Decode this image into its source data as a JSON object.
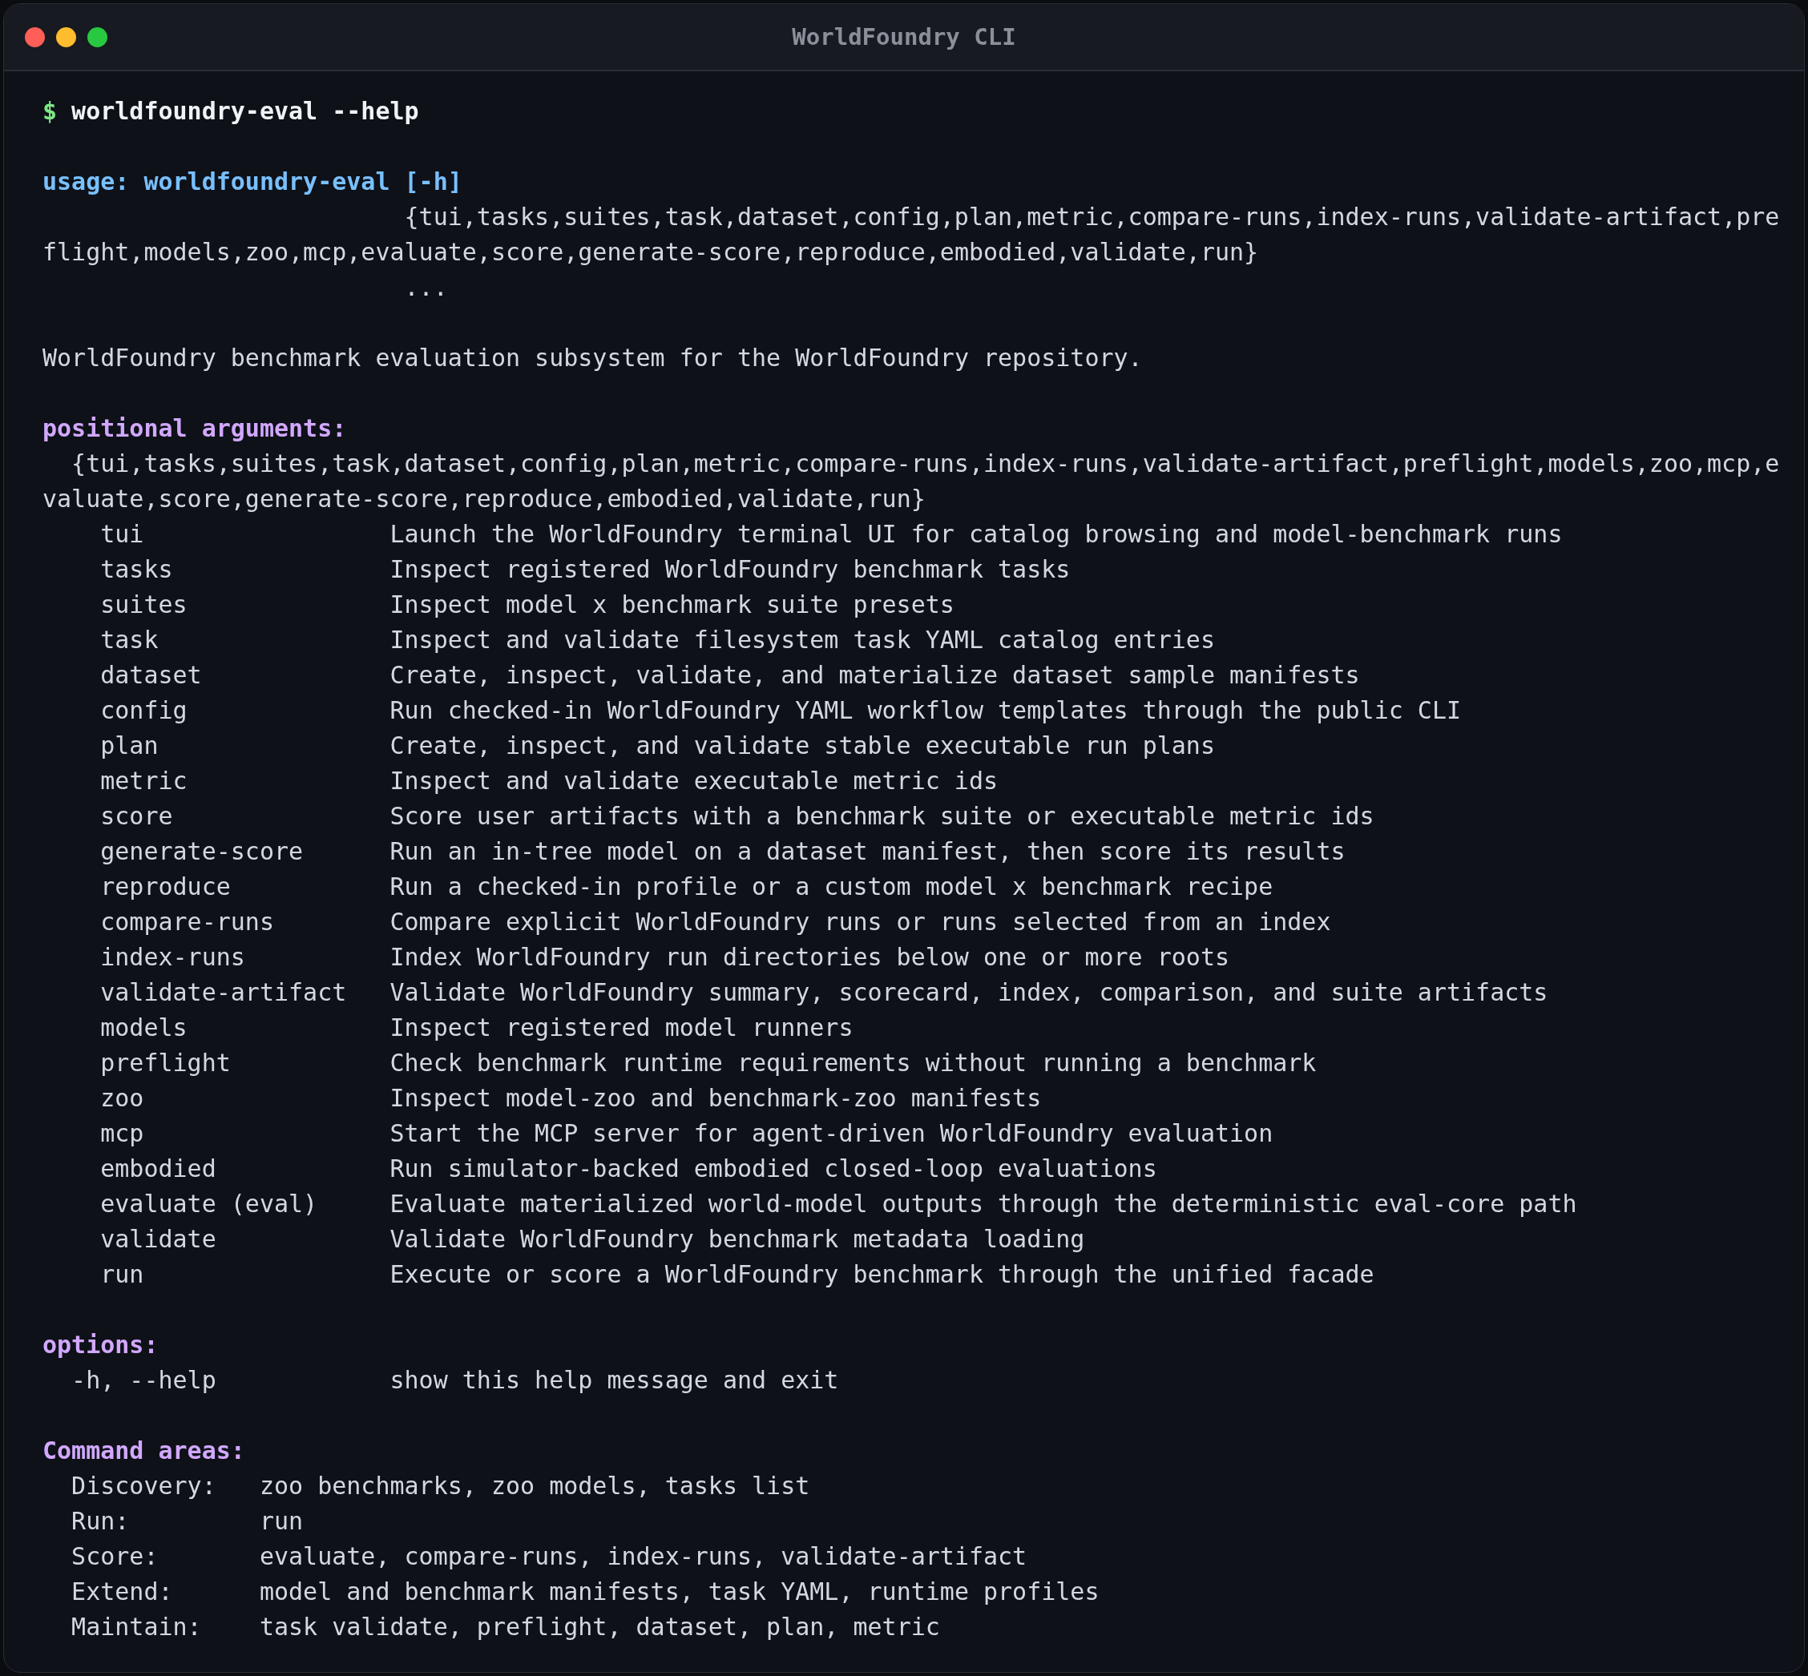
{
  "window": {
    "title": "WorldFoundry CLI"
  },
  "prompt": {
    "symbol": "$",
    "command": "worldfoundry-eval --help"
  },
  "usage": {
    "line": "usage: worldfoundry-eval [-h]",
    "choices": "{tui,tasks,suites,task,dataset,config,plan,metric,compare-runs,index-runs,validate-artifact,preflight,models,zoo,mcp,evaluate,score,generate-score,reproduce,embodied,validate,run}",
    "ellipsis": "..."
  },
  "description": "WorldFoundry benchmark evaluation subsystem for the WorldFoundry repository.",
  "positional": {
    "heading": "positional arguments:",
    "choices": "{tui,tasks,suites,task,dataset,config,plan,metric,compare-runs,index-runs,validate-artifact,preflight,models,zoo,mcp,evaluate,score,generate-score,reproduce,embodied,validate,run}",
    "commands": [
      {
        "name": "tui",
        "help": "Launch the WorldFoundry terminal UI for catalog browsing and model-benchmark runs"
      },
      {
        "name": "tasks",
        "help": "Inspect registered WorldFoundry benchmark tasks"
      },
      {
        "name": "suites",
        "help": "Inspect model x benchmark suite presets"
      },
      {
        "name": "task",
        "help": "Inspect and validate filesystem task YAML catalog entries"
      },
      {
        "name": "dataset",
        "help": "Create, inspect, validate, and materialize dataset sample manifests"
      },
      {
        "name": "config",
        "help": "Run checked-in WorldFoundry YAML workflow templates through the public CLI"
      },
      {
        "name": "plan",
        "help": "Create, inspect, and validate stable executable run plans"
      },
      {
        "name": "metric",
        "help": "Inspect and validate executable metric ids"
      },
      {
        "name": "score",
        "help": "Score user artifacts with a benchmark suite or executable metric ids"
      },
      {
        "name": "generate-score",
        "help": "Run an in-tree model on a dataset manifest, then score its results"
      },
      {
        "name": "reproduce",
        "help": "Run a checked-in profile or a custom model x benchmark recipe"
      },
      {
        "name": "compare-runs",
        "help": "Compare explicit WorldFoundry runs or runs selected from an index"
      },
      {
        "name": "index-runs",
        "help": "Index WorldFoundry run directories below one or more roots"
      },
      {
        "name": "validate-artifact",
        "help": "Validate WorldFoundry summary, scorecard, index, comparison, and suite artifacts"
      },
      {
        "name": "models",
        "help": "Inspect registered model runners"
      },
      {
        "name": "preflight",
        "help": "Check benchmark runtime requirements without running a benchmark"
      },
      {
        "name": "zoo",
        "help": "Inspect model-zoo and benchmark-zoo manifests"
      },
      {
        "name": "mcp",
        "help": "Start the MCP server for agent-driven WorldFoundry evaluation"
      },
      {
        "name": "embodied",
        "help": "Run simulator-backed embodied closed-loop evaluations"
      },
      {
        "name": "evaluate (eval)",
        "help": "Evaluate materialized world-model outputs through the deterministic eval-core path"
      },
      {
        "name": "validate",
        "help": "Validate WorldFoundry benchmark metadata loading"
      },
      {
        "name": "run",
        "help": "Execute or score a WorldFoundry benchmark through the unified facade"
      }
    ]
  },
  "options": {
    "heading": "options:",
    "items": [
      {
        "flag": "-h, --help",
        "help": "show this help message and exit"
      }
    ]
  },
  "command_areas": {
    "heading": "Command areas:",
    "items": [
      {
        "label": "Discovery:",
        "value": "zoo benchmarks, zoo models, tasks list"
      },
      {
        "label": "Run:",
        "value": "run"
      },
      {
        "label": "Score:",
        "value": "evaluate, compare-runs, index-runs, validate-artifact"
      },
      {
        "label": "Extend:",
        "value": "model and benchmark manifests, task YAML, runtime profiles"
      },
      {
        "label": "Maintain:",
        "value": "task validate, preflight, dataset, plan, metric"
      }
    ]
  }
}
